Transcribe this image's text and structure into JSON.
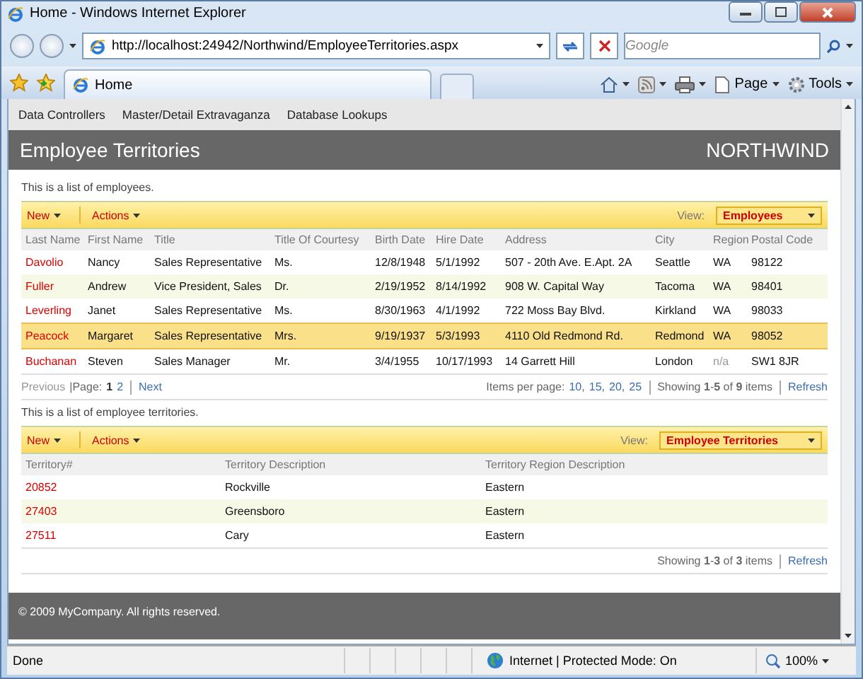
{
  "window": {
    "title": "Home - Windows Internet Explorer"
  },
  "address": {
    "url": "http://localhost:24942/Northwind/EmployeeTerritories.aspx"
  },
  "search": {
    "placeholder": "Google"
  },
  "tab": {
    "label": "Home"
  },
  "toolbar": [
    {
      "kind": "home"
    },
    {
      "kind": "feeds"
    },
    {
      "kind": "print"
    },
    {
      "kind": "page",
      "label": "Page"
    },
    {
      "kind": "tools",
      "label": "Tools"
    }
  ],
  "menu": [
    "Data Controllers",
    "Master/Detail Extravaganza",
    "Database Lookups"
  ],
  "header": {
    "title": "Employee Territories",
    "brand": "NORTHWIND"
  },
  "grids": [
    {
      "description": "This is a list of employees.",
      "new": "New",
      "actions": "Actions",
      "view_label": "View:",
      "view": "Employees",
      "columns": [
        "Last Name",
        "First Name",
        "Title",
        "Title Of Courtesy",
        "Birth Date",
        "Hire Date",
        "Address",
        "City",
        "Region",
        "Postal Code"
      ],
      "rows": [
        {
          "selected": false,
          "cells": [
            "Davolio",
            "Nancy",
            "Sales Representative",
            "Ms.",
            "12/8/1948",
            "5/1/1992",
            "507 - 20th Ave. E.Apt. 2A",
            "Seattle",
            "WA",
            "98122"
          ]
        },
        {
          "selected": false,
          "cells": [
            "Fuller",
            "Andrew",
            "Vice President, Sales",
            "Dr.",
            "2/19/1952",
            "8/14/1992",
            "908 W. Capital Way",
            "Tacoma",
            "WA",
            "98401"
          ]
        },
        {
          "selected": false,
          "cells": [
            "Leverling",
            "Janet",
            "Sales Representative",
            "Ms.",
            "8/30/1963",
            "4/1/1992",
            "722 Moss Bay Blvd.",
            "Kirkland",
            "WA",
            "98033"
          ]
        },
        {
          "selected": true,
          "cells": [
            "Peacock",
            "Margaret",
            "Sales Representative",
            "Mrs.",
            "9/19/1937",
            "5/3/1993",
            "4110 Old Redmond Rd.",
            "Redmond",
            "WA",
            "98052"
          ]
        },
        {
          "selected": false,
          "cells": [
            "Buchanan",
            "Steven",
            "Sales Manager",
            "Mr.",
            "3/4/1955",
            "10/17/1993",
            "14 Garrett Hill",
            "London",
            {
              "text": "n/a",
              "muted": true
            },
            "SW1 8JR"
          ]
        }
      ],
      "pager": {
        "previous": {
          "label": "Previous",
          "disabled": true
        },
        "page_label": "|Page:",
        "pages": [
          {
            "label": "1",
            "selected": true
          },
          {
            "label": "2",
            "selected": false
          }
        ],
        "next": {
          "label": "Next",
          "disabled": false
        },
        "per_page_label": "Items per page:",
        "sizes": [
          "10",
          "15",
          "20",
          "25"
        ],
        "size_separator": ","
      },
      "showing": "Showing **1**-**5** of **9** items",
      "refresh": "Refresh"
    },
    {
      "description": "This is a list of employee territories.",
      "new": "New",
      "actions": "Actions",
      "view_label": "View:",
      "view": "Employee Territories",
      "columns": [
        "Territory#",
        "Territory Description",
        "Territory Region Description"
      ],
      "rows": [
        {
          "selected": false,
          "cells": [
            "20852",
            "Rockville",
            "Eastern"
          ]
        },
        {
          "selected": false,
          "cells": [
            "27403",
            "Greensboro",
            "Eastern"
          ]
        },
        {
          "selected": false,
          "cells": [
            "27511",
            "Cary",
            "Eastern"
          ]
        }
      ],
      "showing": "Showing **1**-**3** of **3** items",
      "refresh": "Refresh"
    }
  ],
  "footer": "© 2009 MyCompany. All rights reserved.",
  "status": {
    "text": "Done",
    "zone": "Internet | Protected Mode: On",
    "zoom": "100%"
  }
}
